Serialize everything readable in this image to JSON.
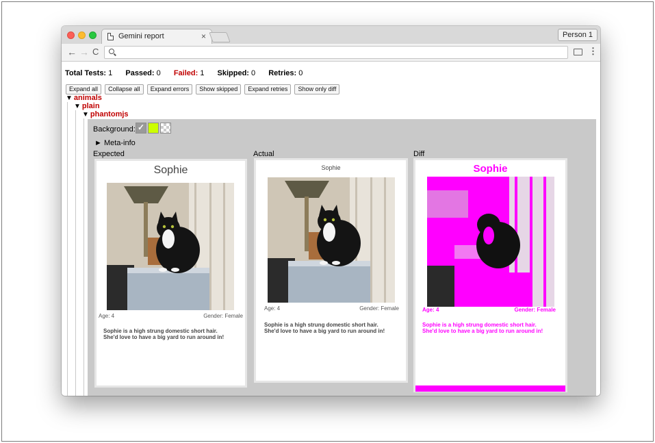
{
  "browser": {
    "tab_title": "Gemini report",
    "tab_close": "×",
    "profile": "Person 1",
    "nav": {
      "back": "←",
      "forward": "→",
      "reload": "C",
      "menu": "⋮"
    },
    "icons": {
      "tab": "document-icon",
      "omnibox": "search-icon",
      "cast": "cast-icon"
    }
  },
  "summary": {
    "total_label": "Total Tests:",
    "total": "1",
    "passed_label": "Passed:",
    "passed": "0",
    "failed_label": "Failed:",
    "failed": "1",
    "skipped_label": "Skipped:",
    "skipped": "0",
    "retries_label": "Retries:",
    "retries": "0"
  },
  "buttons": [
    "Expand all",
    "Collapse all",
    "Expand errors",
    "Show skipped",
    "Expand retries",
    "Show only diff"
  ],
  "tree": {
    "suite": "animals",
    "test": "plain",
    "browser": "phantomjs",
    "toggle": "▼"
  },
  "state": {
    "background_label": "Background:",
    "swatch_check": "✓",
    "meta_info": "► Meta-info",
    "labels": {
      "expected": "Expected",
      "actual": "Actual",
      "diff": "Diff"
    }
  },
  "expected_card": {
    "name": "Sophie",
    "age": "Age: 4",
    "gender": "Gender: Female",
    "desc_1": "Sophie is a high strung domestic short hair.",
    "desc_2": "She'd love to have a big yard to run around in!"
  },
  "actual_card": {
    "name": "Sophie",
    "age": "Age: 4",
    "gender": "Gender: Female",
    "desc_1": "Sophie is a high strung domestic short hair.",
    "desc_2": "She'd love to have a big yard to run around in!"
  },
  "diff_card": {
    "name": "Sophie",
    "age": "Age: 4",
    "gender": "Gender: Female",
    "desc_1": "Sophie is a high strung domestic short hair.",
    "desc_2": "She'd love to have a big yard to run around in!"
  },
  "colors": {
    "failed": "#c00000",
    "diff": "#ff00ff",
    "swatch_green": "#ccff00"
  }
}
